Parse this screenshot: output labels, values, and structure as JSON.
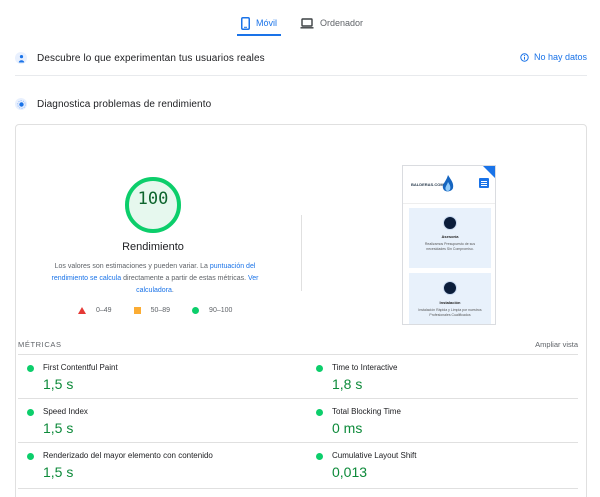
{
  "tabs": [
    {
      "label": "Móvil",
      "active": true,
      "icon": "smartphone-icon"
    },
    {
      "label": "Ordenador",
      "active": false,
      "icon": "laptop-icon"
    }
  ],
  "field_data": {
    "title": "Descubre lo que experimentan tus usuarios reales",
    "no_data": "No hay datos",
    "icon": "users-icon"
  },
  "diagnostics": {
    "title": "Diagnostica problemas de rendimiento",
    "icon": "lighthouse-icon"
  },
  "score": {
    "value": "100",
    "fraction": 1.0,
    "label": "Rendimiento",
    "desc_pre": "Los valores son estimaciones y pueden variar. La ",
    "desc_link1": "puntuación del rendimiento se calcula",
    "desc_mid": " directamente a partir de estas métricas. ",
    "desc_link2": "Ver calculadora",
    "desc_end": ".",
    "color": "#0cce6b"
  },
  "legend": [
    {
      "range": "0–49",
      "shape": "triangle",
      "color": "#e53935"
    },
    {
      "range": "50–89",
      "shape": "square",
      "color": "#fbac33"
    },
    {
      "range": "90–100",
      "shape": "circle",
      "color": "#0cce6b"
    }
  ],
  "thumbnail": {
    "logo_text": "BALDERAS.COM",
    "tile1_title": "Asesoría",
    "tile1_text": "Realizamos Presupuesto de sus necesidades Sin Compromiso.",
    "tile2_title": "Instalación",
    "tile2_text": "Instalación Rápida y Limpia por nuestros Profesionales Cualificados"
  },
  "metrics": {
    "header": "MÉTRICAS",
    "expand_label": "Ampliar vista",
    "items": [
      {
        "name": "First Contentful Paint",
        "value": "1,5 s"
      },
      {
        "name": "Time to Interactive",
        "value": "1,8 s"
      },
      {
        "name": "Speed Index",
        "value": "1,5 s"
      },
      {
        "name": "Total Blocking Time",
        "value": "0 ms"
      },
      {
        "name": "Renderizado del mayor elemento con contenido",
        "value": "1,5 s"
      },
      {
        "name": "Cumulative Layout Shift",
        "value": "0,013"
      }
    ]
  }
}
